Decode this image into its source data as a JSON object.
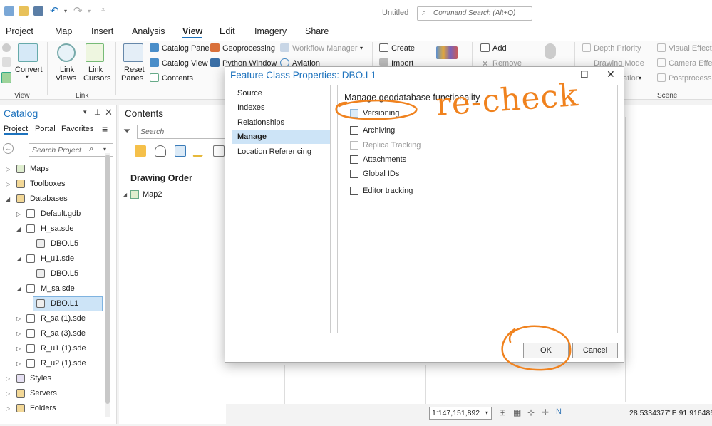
{
  "app": {
    "doc_title": "Untitled",
    "command_search_placeholder": "Command Search (Alt+Q)"
  },
  "menu_tabs": [
    "Project",
    "Map",
    "Insert",
    "Analysis",
    "View",
    "Edit",
    "Imagery",
    "Share"
  ],
  "active_tab": "View",
  "ribbon": {
    "convert": "Convert",
    "link_views": [
      "Link",
      "Views"
    ],
    "link_cursors": [
      "Link",
      "Cursors"
    ],
    "reset_panes": [
      "Reset",
      "Panes"
    ],
    "catalog_pane": "Catalog Pane",
    "catalog_view": "Catalog View",
    "contents": "Contents",
    "geoprocessing": "Geoprocessing",
    "python_window": "Python Window",
    "workflow_manager": "Workflow Manager",
    "aviation": "Aviation",
    "create": "Create",
    "import": "Import",
    "add": "Add",
    "remove": "Remove",
    "depth_priority": "Depth Priority",
    "drawing_mode": "Drawing Mode",
    "ation": "ation",
    "visual_effect": "Visual Effect",
    "camera_effect": "Camera Effec",
    "postprocessing": "Postprocessin",
    "groups": {
      "view": "View",
      "link": "Link",
      "scene": "Scene"
    }
  },
  "catalog": {
    "title": "Catalog",
    "tabs": [
      "Project",
      "Portal",
      "Favorites"
    ],
    "search_placeholder": "Search Project",
    "items": [
      "Maps",
      "Toolboxes",
      "Databases",
      "Default.gdb",
      "H_sa.sde",
      "DBO.L5",
      "H_u1.sde",
      "DBO.L5",
      "M_sa.sde",
      "DBO.L1",
      "R_sa (1).sde",
      "R_sa (3).sde",
      "R_u1 (1).sde",
      "R_u2 (1).sde",
      "Styles",
      "Servers",
      "Folders"
    ]
  },
  "contents_pane": {
    "title": "Contents",
    "search_placeholder": "Search",
    "drawing_order": "Drawing Order",
    "map": "Map2"
  },
  "dialog": {
    "title": "Feature Class Properties: DBO.L1",
    "nav": [
      "Source",
      "Indexes",
      "Relationships",
      "Manage",
      "Location Referencing"
    ],
    "selected_nav": "Manage",
    "heading": "Manage geodatabase functionality",
    "options": [
      {
        "label": "Versioning",
        "checked": false,
        "enabled": true
      },
      {
        "label": "Archiving",
        "checked": false,
        "enabled": true
      },
      {
        "label": "Replica Tracking",
        "checked": false,
        "enabled": false
      },
      {
        "label": "Attachments",
        "checked": false,
        "enabled": true
      },
      {
        "label": "Global IDs",
        "checked": false,
        "enabled": true
      },
      {
        "label": "Editor tracking",
        "checked": false,
        "enabled": true
      }
    ],
    "ok": "OK",
    "cancel": "Cancel",
    "annotation": "re-check"
  },
  "status": {
    "scale": "1:147,151,892",
    "coords": "28.5334377°E 91.9164869"
  },
  "colors": {
    "accent": "#1e73be",
    "annotation": "#f0821e",
    "selection": "#cde4f7"
  }
}
